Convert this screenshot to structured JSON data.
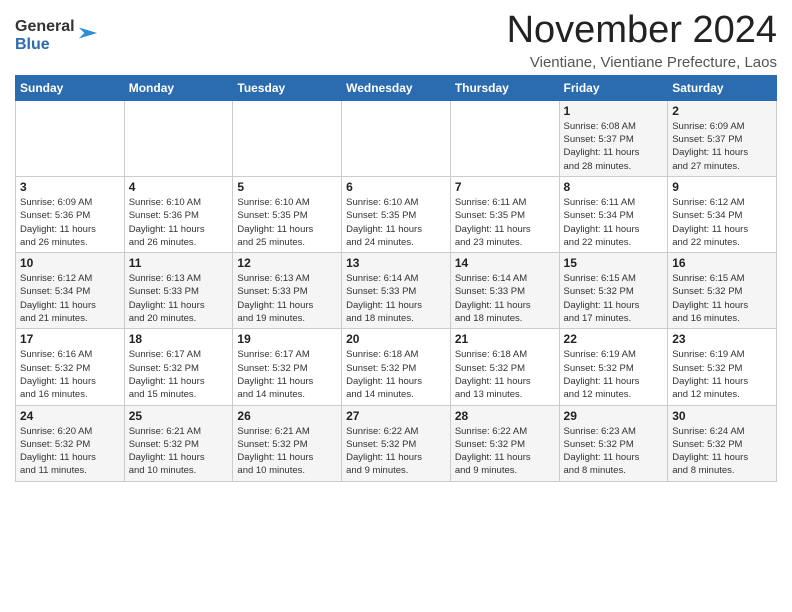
{
  "logo": {
    "general": "General",
    "blue": "Blue"
  },
  "title": "November 2024",
  "subtitle": "Vientiane, Vientiane Prefecture, Laos",
  "days_of_week": [
    "Sunday",
    "Monday",
    "Tuesday",
    "Wednesday",
    "Thursday",
    "Friday",
    "Saturday"
  ],
  "weeks": [
    [
      {
        "day": "",
        "info": ""
      },
      {
        "day": "",
        "info": ""
      },
      {
        "day": "",
        "info": ""
      },
      {
        "day": "",
        "info": ""
      },
      {
        "day": "",
        "info": ""
      },
      {
        "day": "1",
        "info": "Sunrise: 6:08 AM\nSunset: 5:37 PM\nDaylight: 11 hours\nand 28 minutes."
      },
      {
        "day": "2",
        "info": "Sunrise: 6:09 AM\nSunset: 5:37 PM\nDaylight: 11 hours\nand 27 minutes."
      }
    ],
    [
      {
        "day": "3",
        "info": "Sunrise: 6:09 AM\nSunset: 5:36 PM\nDaylight: 11 hours\nand 26 minutes."
      },
      {
        "day": "4",
        "info": "Sunrise: 6:10 AM\nSunset: 5:36 PM\nDaylight: 11 hours\nand 26 minutes."
      },
      {
        "day": "5",
        "info": "Sunrise: 6:10 AM\nSunset: 5:35 PM\nDaylight: 11 hours\nand 25 minutes."
      },
      {
        "day": "6",
        "info": "Sunrise: 6:10 AM\nSunset: 5:35 PM\nDaylight: 11 hours\nand 24 minutes."
      },
      {
        "day": "7",
        "info": "Sunrise: 6:11 AM\nSunset: 5:35 PM\nDaylight: 11 hours\nand 23 minutes."
      },
      {
        "day": "8",
        "info": "Sunrise: 6:11 AM\nSunset: 5:34 PM\nDaylight: 11 hours\nand 22 minutes."
      },
      {
        "day": "9",
        "info": "Sunrise: 6:12 AM\nSunset: 5:34 PM\nDaylight: 11 hours\nand 22 minutes."
      }
    ],
    [
      {
        "day": "10",
        "info": "Sunrise: 6:12 AM\nSunset: 5:34 PM\nDaylight: 11 hours\nand 21 minutes."
      },
      {
        "day": "11",
        "info": "Sunrise: 6:13 AM\nSunset: 5:33 PM\nDaylight: 11 hours\nand 20 minutes."
      },
      {
        "day": "12",
        "info": "Sunrise: 6:13 AM\nSunset: 5:33 PM\nDaylight: 11 hours\nand 19 minutes."
      },
      {
        "day": "13",
        "info": "Sunrise: 6:14 AM\nSunset: 5:33 PM\nDaylight: 11 hours\nand 18 minutes."
      },
      {
        "day": "14",
        "info": "Sunrise: 6:14 AM\nSunset: 5:33 PM\nDaylight: 11 hours\nand 18 minutes."
      },
      {
        "day": "15",
        "info": "Sunrise: 6:15 AM\nSunset: 5:32 PM\nDaylight: 11 hours\nand 17 minutes."
      },
      {
        "day": "16",
        "info": "Sunrise: 6:15 AM\nSunset: 5:32 PM\nDaylight: 11 hours\nand 16 minutes."
      }
    ],
    [
      {
        "day": "17",
        "info": "Sunrise: 6:16 AM\nSunset: 5:32 PM\nDaylight: 11 hours\nand 16 minutes."
      },
      {
        "day": "18",
        "info": "Sunrise: 6:17 AM\nSunset: 5:32 PM\nDaylight: 11 hours\nand 15 minutes."
      },
      {
        "day": "19",
        "info": "Sunrise: 6:17 AM\nSunset: 5:32 PM\nDaylight: 11 hours\nand 14 minutes."
      },
      {
        "day": "20",
        "info": "Sunrise: 6:18 AM\nSunset: 5:32 PM\nDaylight: 11 hours\nand 14 minutes."
      },
      {
        "day": "21",
        "info": "Sunrise: 6:18 AM\nSunset: 5:32 PM\nDaylight: 11 hours\nand 13 minutes."
      },
      {
        "day": "22",
        "info": "Sunrise: 6:19 AM\nSunset: 5:32 PM\nDaylight: 11 hours\nand 12 minutes."
      },
      {
        "day": "23",
        "info": "Sunrise: 6:19 AM\nSunset: 5:32 PM\nDaylight: 11 hours\nand 12 minutes."
      }
    ],
    [
      {
        "day": "24",
        "info": "Sunrise: 6:20 AM\nSunset: 5:32 PM\nDaylight: 11 hours\nand 11 minutes."
      },
      {
        "day": "25",
        "info": "Sunrise: 6:21 AM\nSunset: 5:32 PM\nDaylight: 11 hours\nand 10 minutes."
      },
      {
        "day": "26",
        "info": "Sunrise: 6:21 AM\nSunset: 5:32 PM\nDaylight: 11 hours\nand 10 minutes."
      },
      {
        "day": "27",
        "info": "Sunrise: 6:22 AM\nSunset: 5:32 PM\nDaylight: 11 hours\nand 9 minutes."
      },
      {
        "day": "28",
        "info": "Sunrise: 6:22 AM\nSunset: 5:32 PM\nDaylight: 11 hours\nand 9 minutes."
      },
      {
        "day": "29",
        "info": "Sunrise: 6:23 AM\nSunset: 5:32 PM\nDaylight: 11 hours\nand 8 minutes."
      },
      {
        "day": "30",
        "info": "Sunrise: 6:24 AM\nSunset: 5:32 PM\nDaylight: 11 hours\nand 8 minutes."
      }
    ]
  ]
}
